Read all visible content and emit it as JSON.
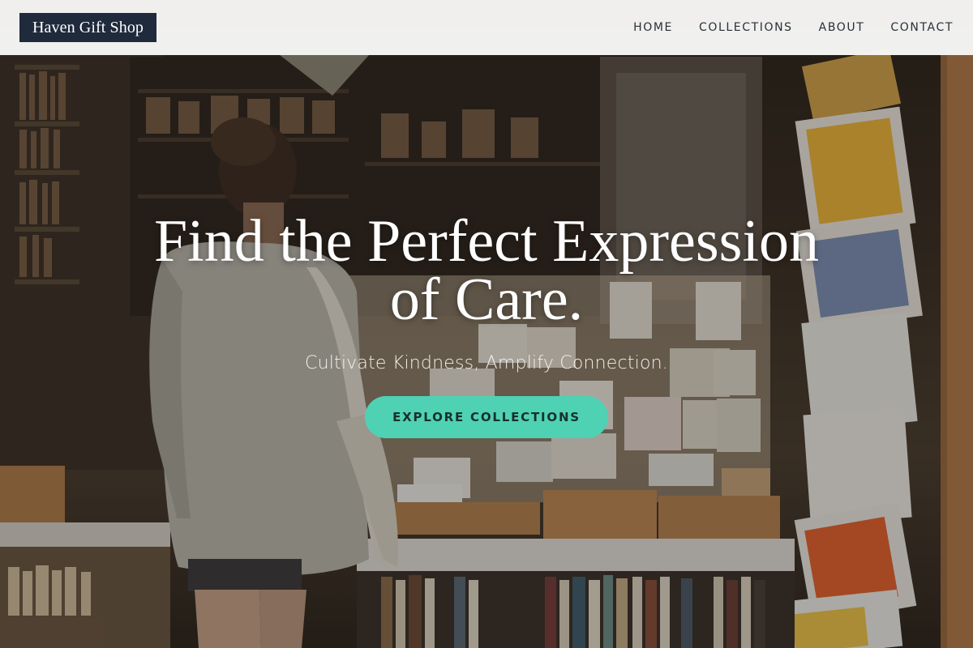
{
  "brand": {
    "name": "Haven Gift Shop"
  },
  "nav": {
    "items": [
      {
        "label": "HOME"
      },
      {
        "label": "COLLECTIONS"
      },
      {
        "label": "ABOUT"
      },
      {
        "label": "CONTACT"
      }
    ]
  },
  "hero": {
    "title": "Find the Perfect Expression of Care.",
    "subtitle": "Cultivate Kindness, Amplify Connection.",
    "cta_label": "EXPLORE COLLECTIONS",
    "image_alt": "shop interior with shelves of cards, books and a customer browsing"
  },
  "colors": {
    "header_bg": "#f7f7f6",
    "logo_bg": "#1f2a3c",
    "cta_bg": "#4fd1b4",
    "nav_text": "#2a2f37"
  }
}
